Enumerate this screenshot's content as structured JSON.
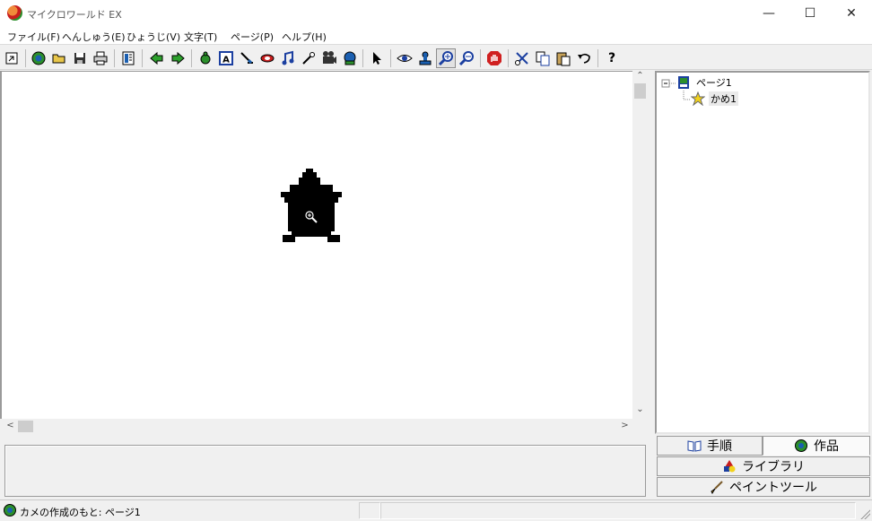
{
  "window": {
    "title": "マイクロワールド EX",
    "controls": {
      "minimize": "—",
      "maximize": "☐",
      "close": "✕"
    }
  },
  "menu": [
    "ファイル(F)",
    "へんしゅう(E)",
    "ひょうじ(V)",
    "文字(T)",
    "ページ(P)",
    "ヘルプ(H)"
  ],
  "toolbar": {
    "buttons": [
      "restore-icon",
      "globe-icon",
      "open-folder-icon",
      "save-disk-icon",
      "print-icon",
      "layout-icon",
      "back-arrow-icon",
      "forward-arrow-icon",
      "new-turtle-icon",
      "text-box-icon",
      "paint-icon",
      "slider-icon",
      "button-icon",
      "music-icon",
      "shape-icon",
      "movie-icon",
      "record-icon",
      "pointer-icon",
      "eye-icon",
      "stamp-icon",
      "zoom-in-icon",
      "zoom-out-icon",
      "stop-hand-icon",
      "cut-icon",
      "copy-icon",
      "paste-icon",
      "undo-icon",
      "help-icon"
    ],
    "help_label": "?",
    "pressed": "zoom-in-icon"
  },
  "scroll": {
    "up": "⌃",
    "down": "⌄",
    "left": "<",
    "right": ">"
  },
  "tree": {
    "root": "ページ1",
    "child": "かめ1"
  },
  "tabs": {
    "procedures": "手順",
    "project": "作品",
    "library": "ライブラリ",
    "paint": "ペイントツール",
    "active": "project"
  },
  "status": {
    "text": "カメの作成のもと: ページ1"
  },
  "colors": {
    "accent_green": "#2c8f2c",
    "accent_red": "#c81e1e",
    "selection": "#eaeaea"
  }
}
